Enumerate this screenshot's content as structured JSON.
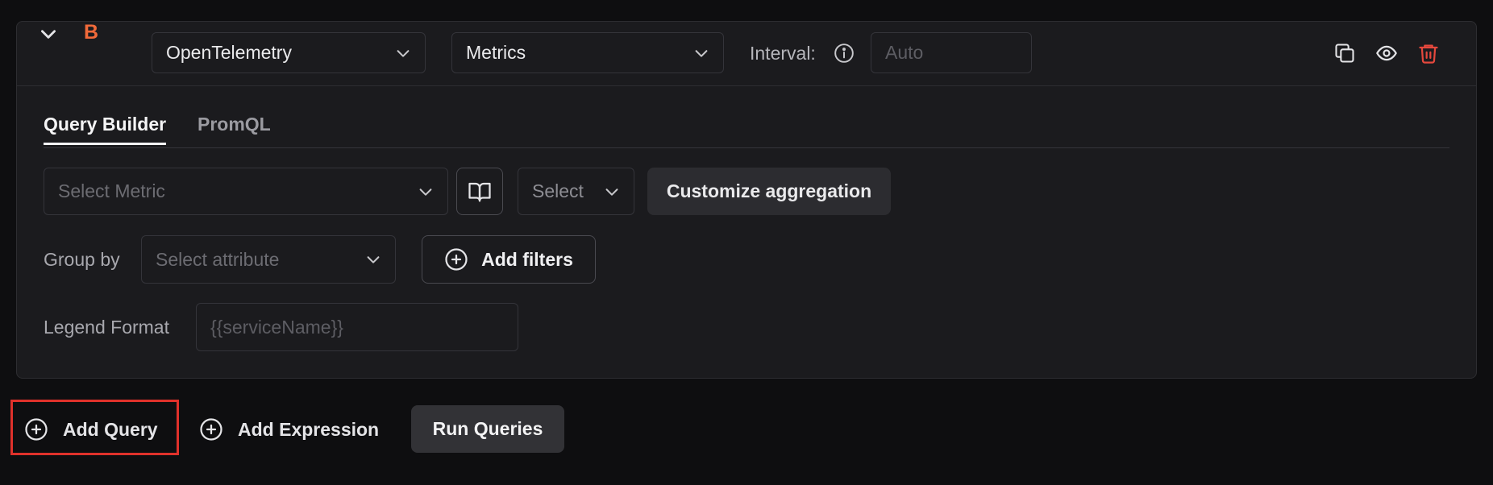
{
  "query": {
    "letter": "B",
    "collapse_icon": "chevron-down-icon",
    "source_select": "OpenTelemetry",
    "type_select": "Metrics",
    "interval_label": "Interval:",
    "interval_placeholder": "Auto",
    "actions": {
      "copy_icon": "copy-icon",
      "view_icon": "eye-icon",
      "delete_icon": "trash-icon"
    },
    "accent_color": "#f16a3a",
    "delete_color": "#e5483d"
  },
  "tabs": [
    {
      "label": "Query Builder",
      "active": true
    },
    {
      "label": "PromQL",
      "active": false
    }
  ],
  "builder": {
    "metric_placeholder": "Select Metric",
    "book_icon": "book-open-icon",
    "aggregation_select": "Select",
    "customize_label": "Customize aggregation",
    "group_by_label": "Group by",
    "group_by_placeholder": "Select attribute",
    "add_filters_label": "Add filters",
    "legend_label": "Legend Format",
    "legend_placeholder": "{{serviceName}}"
  },
  "footer": {
    "add_query_label": "Add Query",
    "add_expression_label": "Add Expression",
    "run_queries_label": "Run Queries",
    "highlight_color": "#e0312b"
  }
}
